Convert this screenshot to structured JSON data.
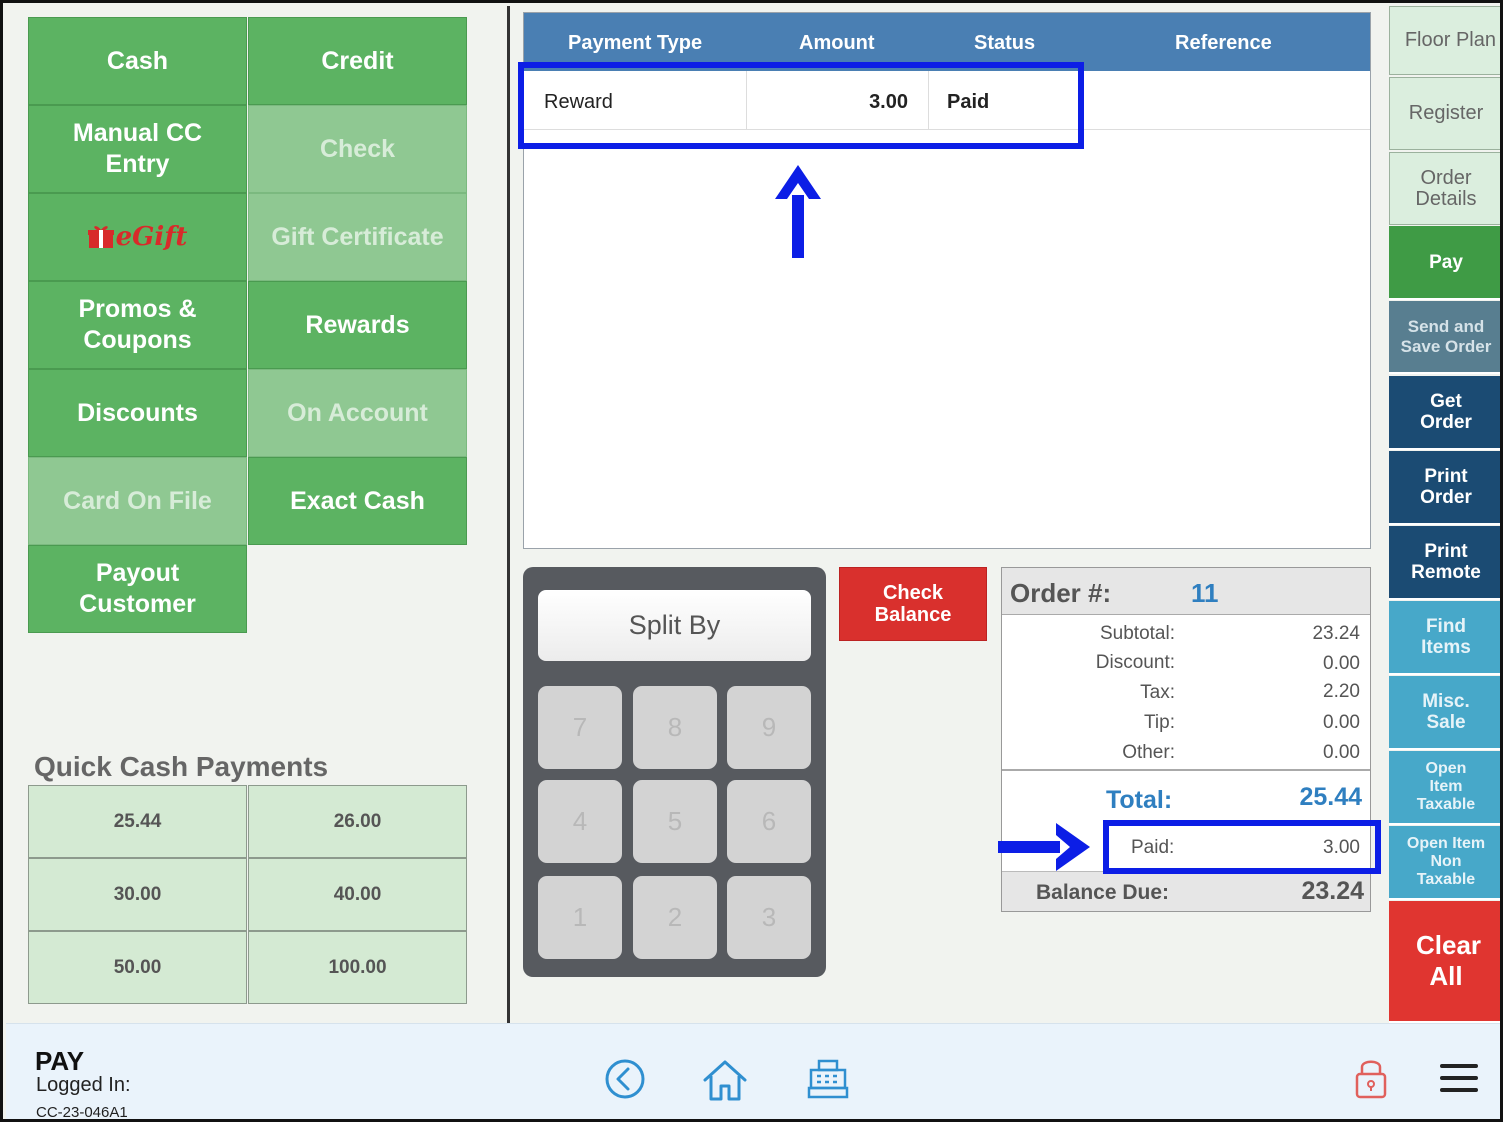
{
  "payment_buttons": {
    "cash": "Cash",
    "credit": "Credit",
    "manual_cc": "Manual CC Entry",
    "check": "Check",
    "egift": "eGift",
    "gift_certificate": "Gift Certificate",
    "promos": "Promos & Coupons",
    "rewards": "Rewards",
    "discounts": "Discounts",
    "on_account": "On Account",
    "card_on_file": "Card On File",
    "exact_cash": "Exact Cash",
    "payout": "Payout Customer"
  },
  "quick_cash": {
    "title": "Quick Cash Payments",
    "amounts": [
      "25.44",
      "26.00",
      "30.00",
      "40.00",
      "50.00",
      "100.00"
    ]
  },
  "payment_table": {
    "headers": [
      "Payment Type",
      "Amount",
      "Status",
      "Reference"
    ],
    "rows": [
      {
        "type": "Reward",
        "amount": "3.00",
        "status": "Paid",
        "reference": ""
      }
    ]
  },
  "keypad": {
    "split_label": "Split By",
    "keys": [
      "7",
      "8",
      "9",
      "4",
      "5",
      "6",
      "1",
      "2",
      "3"
    ]
  },
  "check_balance": "Check Balance",
  "order": {
    "label": "Order #:",
    "number": "11",
    "lines": [
      {
        "label": "Subtotal:",
        "value": "23.24"
      },
      {
        "label": "Discount:",
        "value": "0.00"
      },
      {
        "label": "Tax:",
        "value": "2.20"
      },
      {
        "label": "Tip:",
        "value": "0.00"
      },
      {
        "label": "Other:",
        "value": "0.00"
      }
    ],
    "total_label": "Total:",
    "total_value": "25.44",
    "paid_label": "Paid:",
    "paid_value": "3.00",
    "balance_label": "Balance Due:",
    "balance_value": "23.24"
  },
  "nav": {
    "floor_plan": "Floor Plan",
    "register": "Register",
    "order_details": "Order Details",
    "pay": "Pay",
    "send_save": "Send and Save Order",
    "get_order": "Get Order",
    "print_order": "Print Order",
    "print_remote": "Print Remote",
    "find_items": "Find Items",
    "misc_sale": "Misc. Sale",
    "open_taxable": "Open Item Taxable",
    "open_non_taxable": "Open Item Non Taxable",
    "clear_all": "Clear All"
  },
  "footer": {
    "title": "PAY",
    "logged_in": "Logged In:",
    "device_id": "CC-23-046A1"
  },
  "colors": {
    "highlight": "#0c1ee6",
    "green": "#5cb362",
    "header_blue": "#4a7fb3",
    "red": "#d9302d"
  },
  "icons": [
    "back-circle-icon",
    "home-icon",
    "register-icon",
    "lock-icon",
    "hamburger-menu-icon"
  ]
}
